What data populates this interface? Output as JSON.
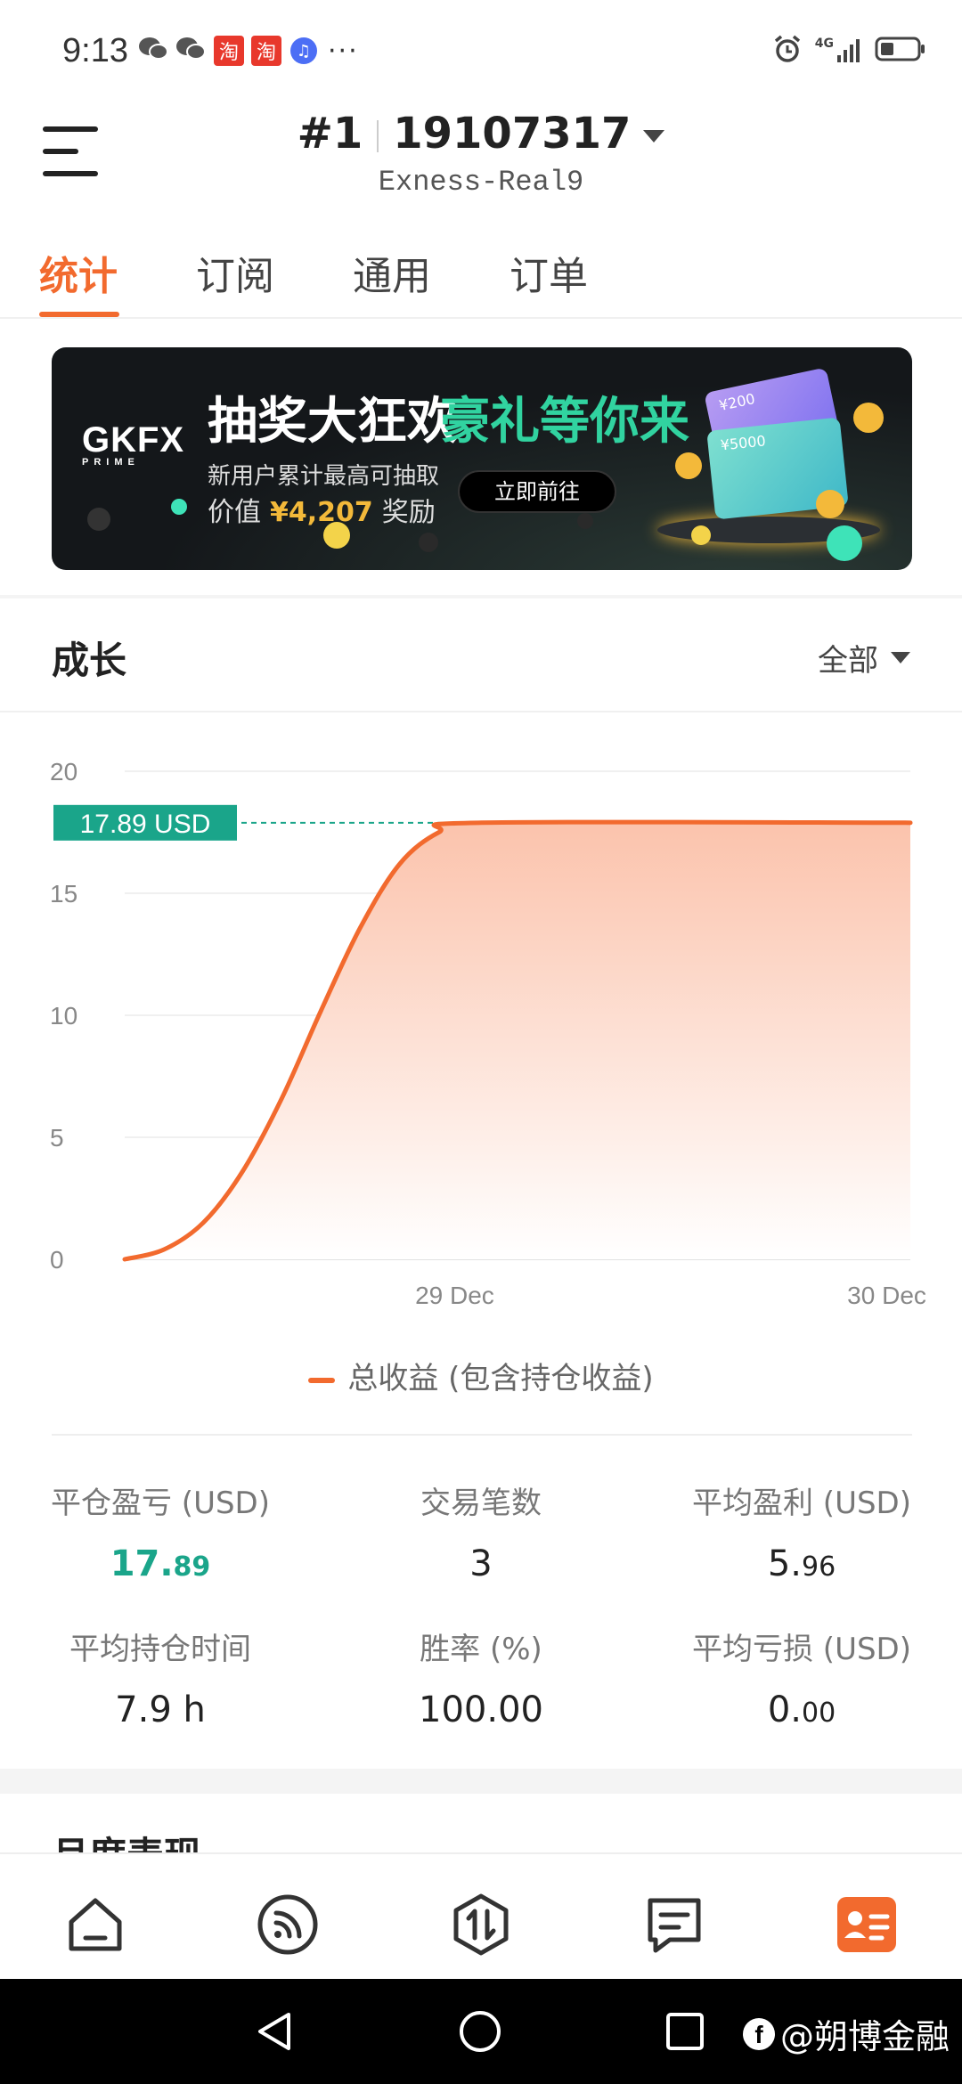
{
  "status_bar": {
    "time": "9:13",
    "network": "4G",
    "icons": [
      "wechat-icon",
      "wechat-icon",
      "taobao-icon",
      "taobao-icon",
      "music-icon",
      "more-dots-icon",
      "alarm-icon",
      "signal-icon",
      "battery-icon"
    ],
    "taobao_glyph": "淘",
    "more": "···"
  },
  "header": {
    "account_index": "#1",
    "account_number": "19107317",
    "server": "Exness-Real9"
  },
  "tabs": [
    {
      "label": "统计",
      "active": true
    },
    {
      "label": "订阅",
      "active": false
    },
    {
      "label": "通用",
      "active": false
    },
    {
      "label": "订单",
      "active": false
    }
  ],
  "banner": {
    "logo": "GKFX",
    "logo_sub": "PRIME",
    "title_white": "抽奖大狂欢",
    "title_green": "豪礼等你来",
    "line1": "新用户累计最高可抽取",
    "line2_prefix": "价值",
    "line2_amount": "¥4,207",
    "line2_suffix": "奖励",
    "button": "立即前往",
    "card1": "¥200",
    "card2": "¥5000"
  },
  "growth": {
    "title": "成长",
    "filter": "全部",
    "legend": "总收益 (包含持仓收益)"
  },
  "chart_data": {
    "type": "area",
    "title": "",
    "ylim": [
      0,
      20
    ],
    "yticks": [
      "20",
      "15",
      "10",
      "5",
      "0"
    ],
    "x_tick_labels": [
      "29 Dec",
      "30 Dec"
    ],
    "current_value_label": "17.89 USD",
    "current_value": 17.89,
    "series": [
      {
        "name": "总收益 (包含持仓收益)",
        "color": "#f26a2e",
        "points": [
          {
            "x": 0.0,
            "y": 0.0
          },
          {
            "x": 0.05,
            "y": 0.4
          },
          {
            "x": 0.1,
            "y": 1.5
          },
          {
            "x": 0.15,
            "y": 3.6
          },
          {
            "x": 0.2,
            "y": 6.6
          },
          {
            "x": 0.25,
            "y": 10.2
          },
          {
            "x": 0.3,
            "y": 13.6
          },
          {
            "x": 0.35,
            "y": 16.2
          },
          {
            "x": 0.4,
            "y": 17.5
          },
          {
            "x": 0.45,
            "y": 17.89
          },
          {
            "x": 1.0,
            "y": 17.89
          }
        ]
      }
    ],
    "colors": {
      "line": "#f26a2e",
      "fill_top": "#fbc3ac",
      "badge": "#1aa58a",
      "ref_line": "#1aa58a"
    }
  },
  "stats": [
    {
      "label": "平仓盈亏 (USD)",
      "value_main": "17.",
      "value_small": "89",
      "green": true
    },
    {
      "label": "交易笔数",
      "value_main": "3",
      "value_small": "",
      "green": false
    },
    {
      "label": "平均盈利 (USD)",
      "value_main": "5.",
      "value_small": "96",
      "green": false
    },
    {
      "label": "平均持仓时间",
      "value_main": "7.9 h",
      "value_small": "",
      "green": false
    },
    {
      "label": "胜率 (%)",
      "value_main": "100.00",
      "value_small": "",
      "green": false
    },
    {
      "label": "平均亏损 (USD)",
      "value_main": "0.",
      "value_small": "00",
      "green": false
    }
  ],
  "monthly": {
    "title": "月度表现"
  },
  "bottom_nav": [
    {
      "icon": "home-icon",
      "active": false
    },
    {
      "icon": "signal-feed-icon",
      "active": false
    },
    {
      "icon": "trade-icon",
      "active": false
    },
    {
      "icon": "messages-icon",
      "active": false
    },
    {
      "icon": "profile-card-icon",
      "active": true
    }
  ],
  "watermark": "@朔博金融",
  "colors": {
    "accent": "#f26a2e",
    "green": "#1aa58a"
  }
}
